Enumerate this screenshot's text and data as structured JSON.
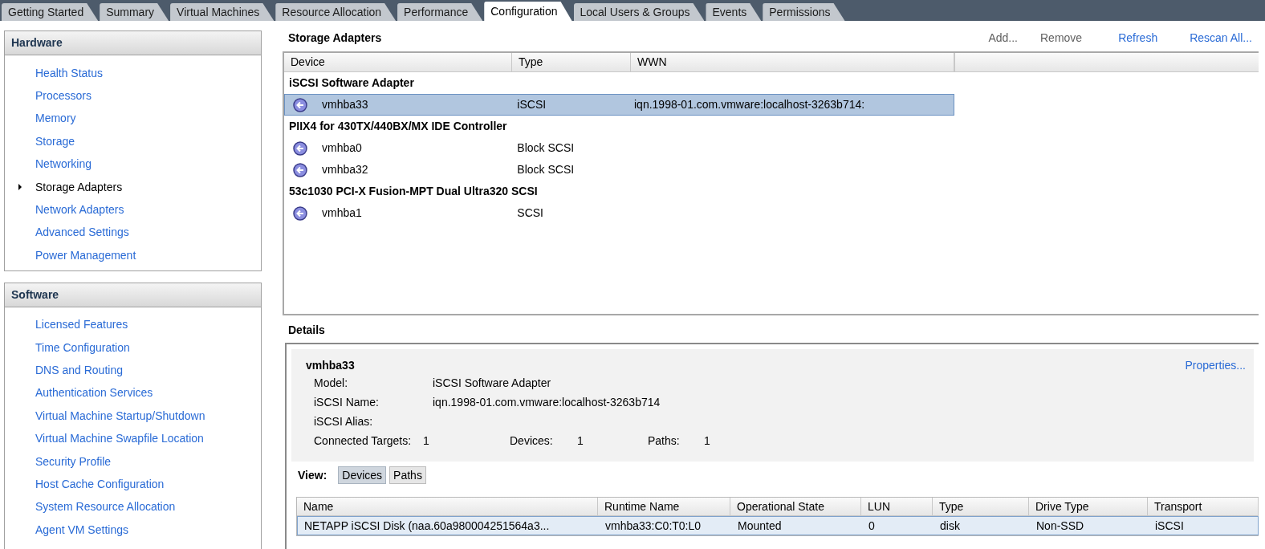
{
  "tabs": [
    {
      "label": "Getting Started",
      "selected": false
    },
    {
      "label": "Summary",
      "selected": false
    },
    {
      "label": "Virtual Machines",
      "selected": false
    },
    {
      "label": "Resource Allocation",
      "selected": false
    },
    {
      "label": "Performance",
      "selected": false
    },
    {
      "label": "Configuration",
      "selected": true
    },
    {
      "label": "Local Users & Groups",
      "selected": false
    },
    {
      "label": "Events",
      "selected": false
    },
    {
      "label": "Permissions",
      "selected": false
    }
  ],
  "sidebar": {
    "sections": [
      {
        "title": "Hardware",
        "items": [
          {
            "label": "Health Status",
            "selected": false
          },
          {
            "label": "Processors",
            "selected": false
          },
          {
            "label": "Memory",
            "selected": false
          },
          {
            "label": "Storage",
            "selected": false
          },
          {
            "label": "Networking",
            "selected": false
          },
          {
            "label": "Storage Adapters",
            "selected": true
          },
          {
            "label": "Network Adapters",
            "selected": false
          },
          {
            "label": "Advanced Settings",
            "selected": false
          },
          {
            "label": "Power Management",
            "selected": false
          }
        ]
      },
      {
        "title": "Software",
        "items": [
          {
            "label": "Licensed Features",
            "selected": false
          },
          {
            "label": "Time Configuration",
            "selected": false
          },
          {
            "label": "DNS and Routing",
            "selected": false
          },
          {
            "label": "Authentication Services",
            "selected": false
          },
          {
            "label": "Virtual Machine Startup/Shutdown",
            "selected": false
          },
          {
            "label": "Virtual Machine Swapfile Location",
            "selected": false
          },
          {
            "label": "Security Profile",
            "selected": false
          },
          {
            "label": "Host Cache Configuration",
            "selected": false
          },
          {
            "label": "System Resource Allocation",
            "selected": false
          },
          {
            "label": "Agent VM Settings",
            "selected": false
          }
        ]
      }
    ]
  },
  "storage_adapters": {
    "title": "Storage Adapters",
    "actions": [
      {
        "label": "Add...",
        "disabled": true
      },
      {
        "label": "Remove",
        "disabled": true
      },
      {
        "label": "Refresh",
        "disabled": false
      },
      {
        "label": "Rescan All...",
        "disabled": false
      }
    ],
    "columns": [
      "Device",
      "Type",
      "WWN"
    ],
    "groups": [
      {
        "name": "iSCSI Software Adapter",
        "adapters": [
          {
            "device": "vmhba33",
            "type": "iSCSI",
            "wwn": "iqn.1998-01.com.vmware:localhost-3263b714:",
            "selected": true
          }
        ]
      },
      {
        "name": "PIIX4 for 430TX/440BX/MX IDE Controller",
        "adapters": [
          {
            "device": "vmhba0",
            "type": "Block SCSI",
            "selected": false
          },
          {
            "device": "vmhba32",
            "type": "Block SCSI",
            "selected": false
          }
        ]
      },
      {
        "name": "53c1030 PCI-X Fusion-MPT Dual Ultra320 SCSI",
        "adapters": [
          {
            "device": "vmhba1",
            "type": "SCSI",
            "selected": false
          }
        ]
      }
    ]
  },
  "details": {
    "title": "Details",
    "name": "vmhba33",
    "properties_link": "Properties...",
    "fields": [
      {
        "label": "Model:",
        "value": "iSCSI Software Adapter"
      },
      {
        "label": "iSCSI Name:",
        "value": "iqn.1998-01.com.vmware:localhost-3263b714"
      },
      {
        "label": "iSCSI Alias:"
      }
    ],
    "counts": [
      {
        "label": "Connected Targets:",
        "value": "1"
      },
      {
        "label": "Devices:",
        "value": "1"
      },
      {
        "label": "Paths:",
        "value": "1"
      }
    ],
    "view": {
      "label": "View:",
      "buttons": [
        {
          "label": "Devices",
          "selected": true
        },
        {
          "label": "Paths",
          "selected": false
        }
      ]
    },
    "table": {
      "columns": [
        "Name",
        "Runtime Name",
        "Operational State",
        "LUN",
        "Type",
        "Drive Type",
        "Transport"
      ],
      "rows": [
        {
          "cells": [
            "NETAPP iSCSI Disk (naa.60a980004251564a3...",
            "vmhba33:C0:T0:L0",
            "Mounted",
            "0",
            "disk",
            "Non-SSD",
            "iSCSI"
          ],
          "selected": true
        }
      ]
    }
  }
}
